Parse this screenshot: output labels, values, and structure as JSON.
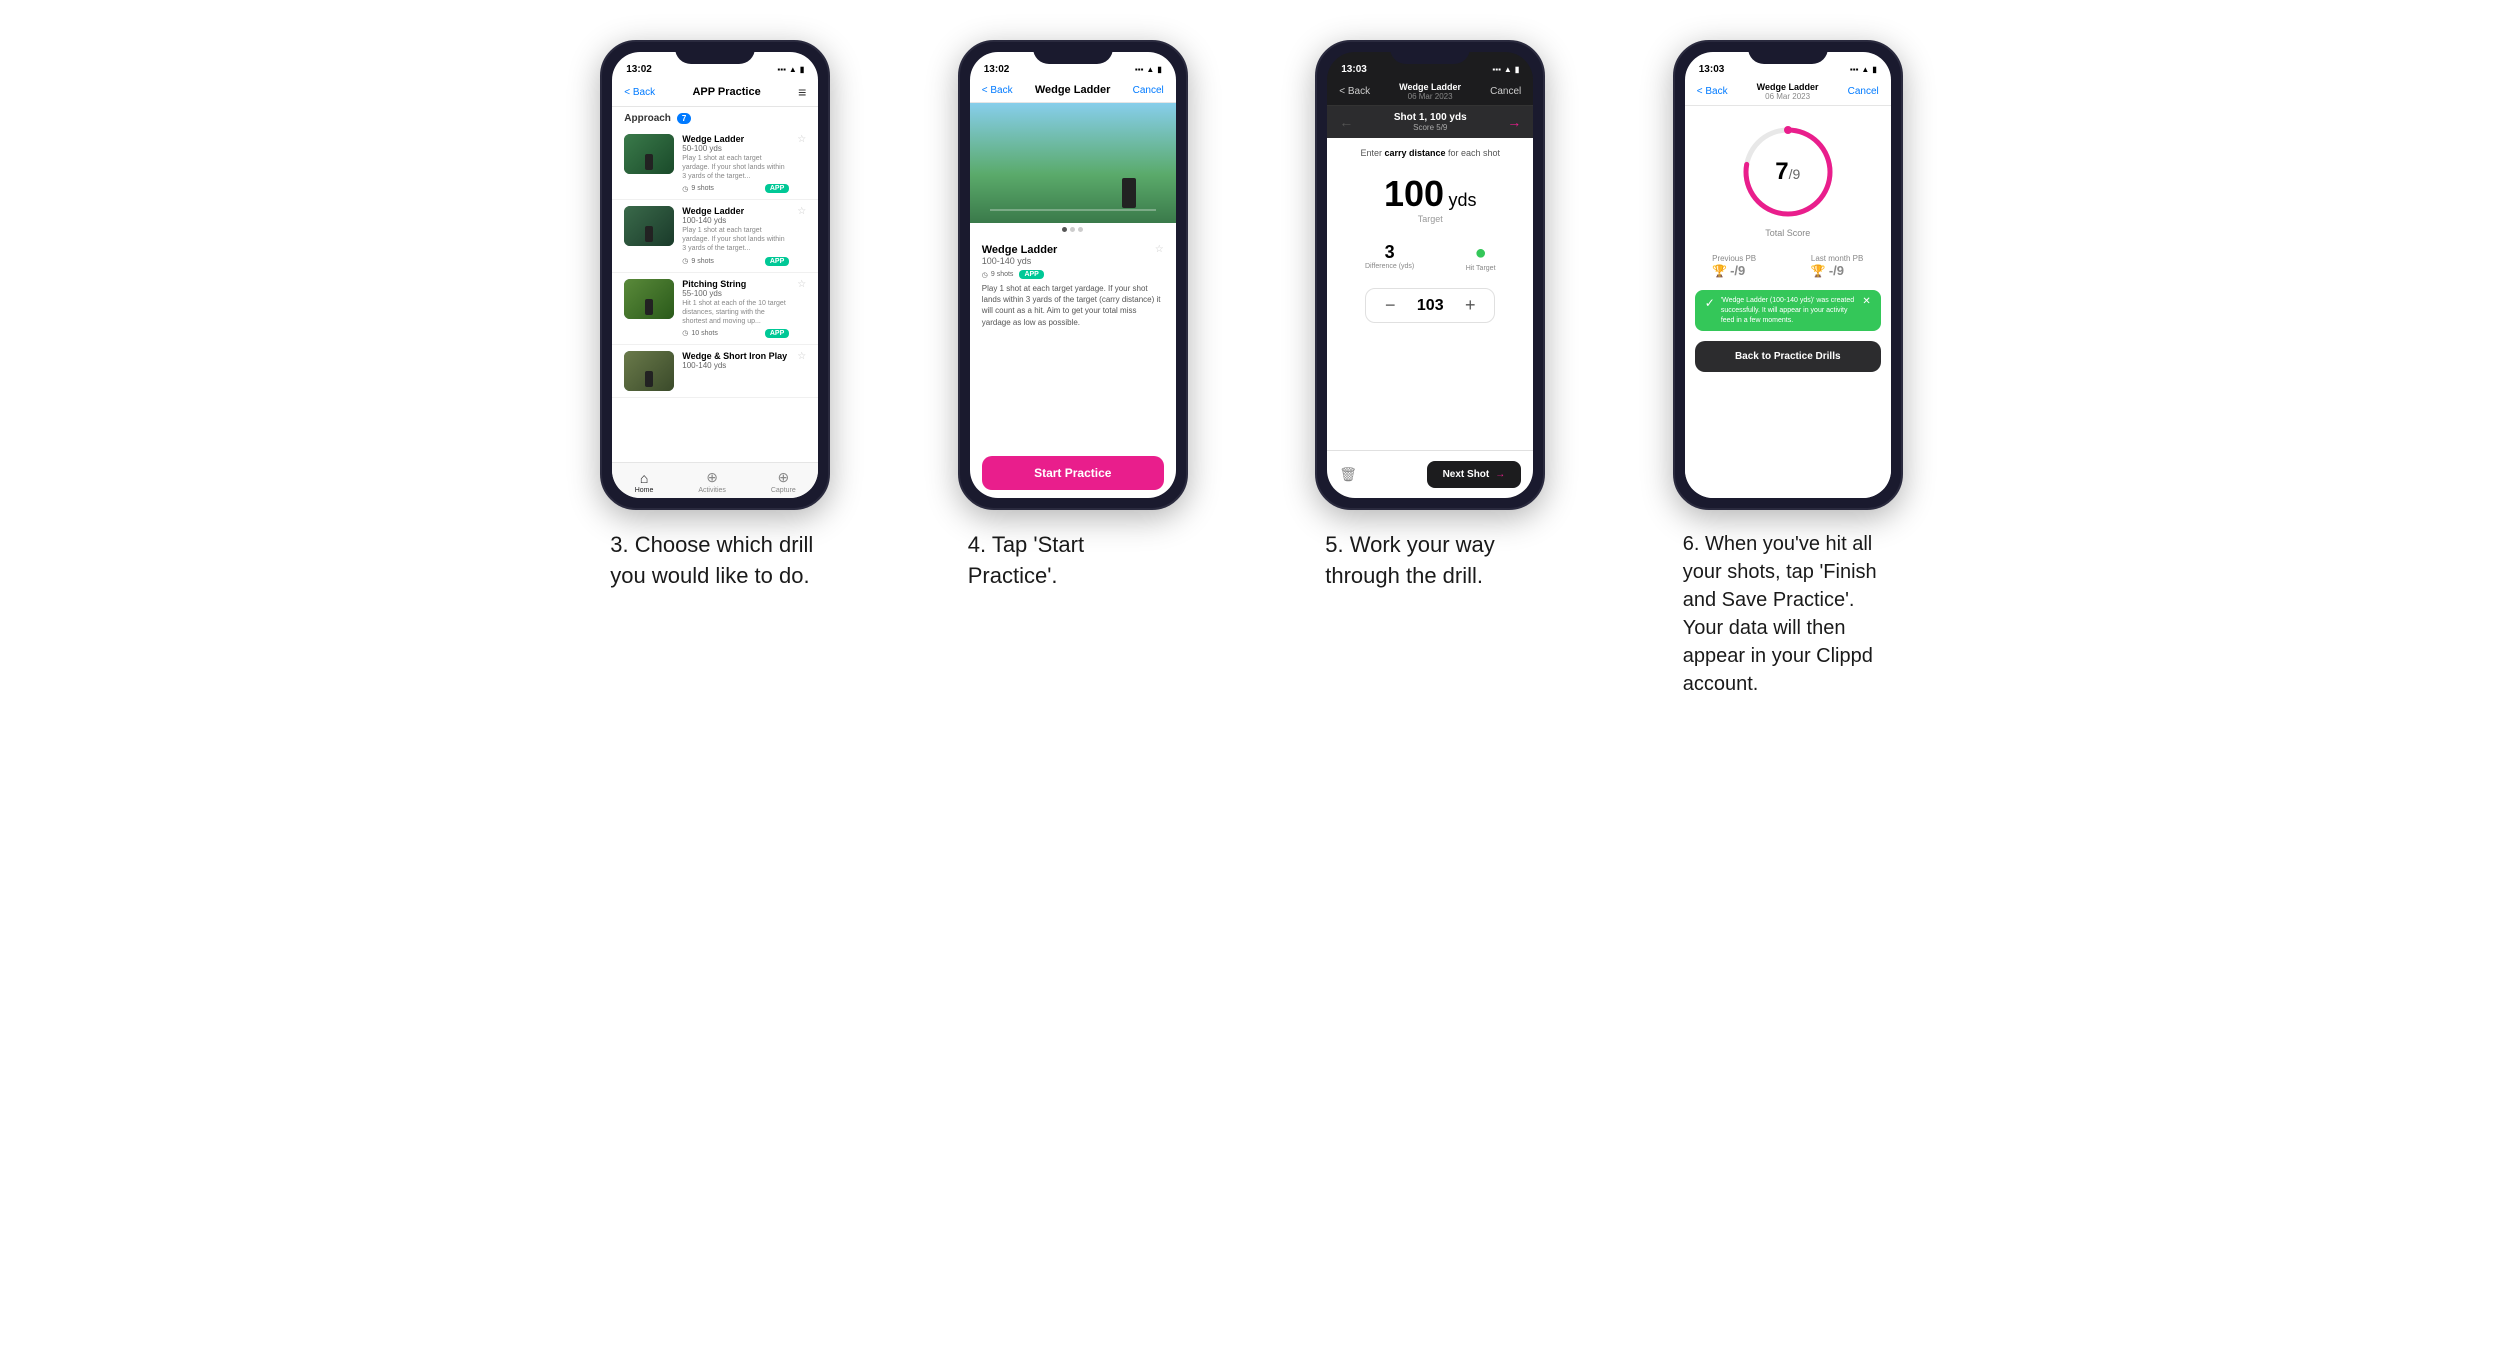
{
  "page": {
    "background": "#ffffff"
  },
  "steps": [
    {
      "id": "step3",
      "description": "3. Choose which drill you would like to do.",
      "phone": {
        "statusBar": {
          "time": "13:02",
          "dark": false
        },
        "nav": {
          "backLabel": "< Back",
          "title": "APP Practice",
          "rightIcon": "menu"
        },
        "sectionLabel": "Approach",
        "sectionCount": "7",
        "drills": [
          {
            "name": "Wedge Ladder",
            "yards": "50-100 yds",
            "desc": "Play 1 shot at each target yardage. If your shot lands within 3 yards of the target...",
            "shots": "9 shots",
            "badge": "APP"
          },
          {
            "name": "Wedge Ladder",
            "yards": "100-140 yds",
            "desc": "Play 1 shot at each target yardage. If your shot lands within 3 yards of the target...",
            "shots": "9 shots",
            "badge": "APP"
          },
          {
            "name": "Pitching String",
            "yards": "55-100 yds",
            "desc": "Hit 1 shot at each of the 10 target distances, starting with the shortest and moving up...",
            "shots": "10 shots",
            "badge": "APP"
          },
          {
            "name": "Wedge & Short Iron Play",
            "yards": "100-140 yds",
            "desc": "",
            "shots": "",
            "badge": ""
          }
        ],
        "bottomNav": [
          {
            "icon": "⌂",
            "label": "Home",
            "active": true
          },
          {
            "icon": "⊕",
            "label": "Activities",
            "active": false
          },
          {
            "icon": "⊕",
            "label": "Capture",
            "active": false
          }
        ]
      }
    },
    {
      "id": "step4",
      "description": "4. Tap 'Start Practice'.",
      "phone": {
        "statusBar": {
          "time": "13:02",
          "dark": false
        },
        "nav": {
          "backLabel": "< Back",
          "title": "Wedge Ladder",
          "rightLabel": "Cancel"
        },
        "drillName": "Wedge Ladder",
        "drillYards": "100-140 yds",
        "shots": "9 shots",
        "badge": "APP",
        "desc": "Play 1 shot at each target yardage. If your shot lands within 3 yards of the target (carry distance) it will count as a hit. Aim to get your total miss yardage as low as possible.",
        "startButton": "Start Practice"
      }
    },
    {
      "id": "step5",
      "description": "5. Work your way through the drill.",
      "phone": {
        "statusBar": {
          "time": "13:03",
          "dark": true
        },
        "navTitle": "Wedge Ladder",
        "navSubtitle": "06 Mar 2023",
        "backLabel": "< Back",
        "cancelLabel": "Cancel",
        "shotLabel": "Shot 1, 100 yds",
        "scoreLabel": "Score 5/9",
        "instruction": "Enter carry distance for each shot",
        "instructionBold": "carry distance",
        "targetYds": "100",
        "targetUnit": "yds",
        "targetLabel": "Target",
        "difference": "3",
        "differenceLabel": "Difference (yds)",
        "hitTargetLabel": "Hit Target",
        "inputValue": "103",
        "nextShotLabel": "Next Shot"
      }
    },
    {
      "id": "step6",
      "description": "6. When you've hit all your shots, tap 'Finish and Save Practice'. Your data will then appear in your Clippd account.",
      "phone": {
        "statusBar": {
          "time": "13:03",
          "dark": false
        },
        "navTitle": "Wedge Ladder",
        "navSubtitle": "06 Mar 2023",
        "backLabel": "< Back",
        "cancelLabel": "Cancel",
        "score": "7",
        "scoreMax": "9",
        "totalScoreLabel": "Total Score",
        "previousPBLabel": "Previous PB",
        "previousPBValue": "-/9",
        "lastMonthPBLabel": "Last month PB",
        "lastMonthPBValue": "-/9",
        "toastText": "'Wedge Ladder (100-140 yds)' was created successfully. It will appear in your activity feed in a few moments.",
        "backDrillsLabel": "Back to Practice Drills"
      }
    }
  ]
}
